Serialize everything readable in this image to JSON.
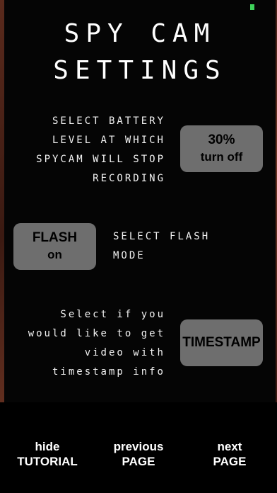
{
  "title": {
    "line1": "SPY CAM",
    "line2": "SETTINGS"
  },
  "battery": {
    "description": "SELECT BATTERY\nLEVEL AT WHICH\nSPYCAM WILL STOP\nRECORDING",
    "value": "30%",
    "sub": "turn off"
  },
  "flash": {
    "description": "SELECT FLASH\nMODE",
    "value": "FLASH",
    "sub": "on"
  },
  "timestamp": {
    "description": "Select if you\nwould like to get\nvideo with\ntimestamp info",
    "value": "TIMESTAMP"
  },
  "bottom_nav": {
    "hide": {
      "line1": "hide",
      "line2": "TUTORIAL"
    },
    "previous": {
      "line1": "previous",
      "line2": "PAGE"
    },
    "next": {
      "line1": "next",
      "line2": "PAGE"
    }
  },
  "colors": {
    "button_bg": "#6e6e6e",
    "status_dot": "#3ed15a",
    "frame": "#5a2a1c"
  }
}
